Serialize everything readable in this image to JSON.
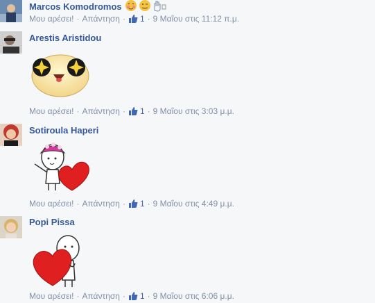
{
  "comments": [
    {
      "author": "Marcos Komodromos",
      "like_label": "Μου αρέσει!",
      "reply_label": "Απάντηση",
      "likes": "1",
      "time": "9 Μαΐου στις 11:12 π.μ.",
      "icons": [
        "blushing-emoji-icon",
        "smiling-emoji-icon",
        "raised-hand-icon",
        "small-square-icon"
      ]
    },
    {
      "author": "Arestis Aristidou",
      "like_label": "Μου αρέσει!",
      "reply_label": "Απάντηση",
      "likes": "1",
      "time": "9 Μαΐου στις 3:03 μ.μ.",
      "sticker": "star-eyes-face-sticker"
    },
    {
      "author": "Sotiroula Haperi",
      "like_label": "Μου αρέσει!",
      "reply_label": "Απάντηση",
      "likes": "1",
      "time": "9 Μαΐου στις 4:49 μ.μ.",
      "sticker": "girl-with-heart-sticker"
    },
    {
      "author": "Popi Pissa",
      "like_label": "Μου αρέσει!",
      "reply_label": "Απάντηση",
      "likes": "1",
      "time": "9 Μαΐου στις 6:06 μ.μ.",
      "sticker": "character-holding-heart-sticker"
    }
  ],
  "colors": {
    "background": "#f6f7f9",
    "author_link": "#365899",
    "meta_text": "#90949c",
    "like_blue": "#4267b2",
    "heart_red": "#e02020"
  }
}
